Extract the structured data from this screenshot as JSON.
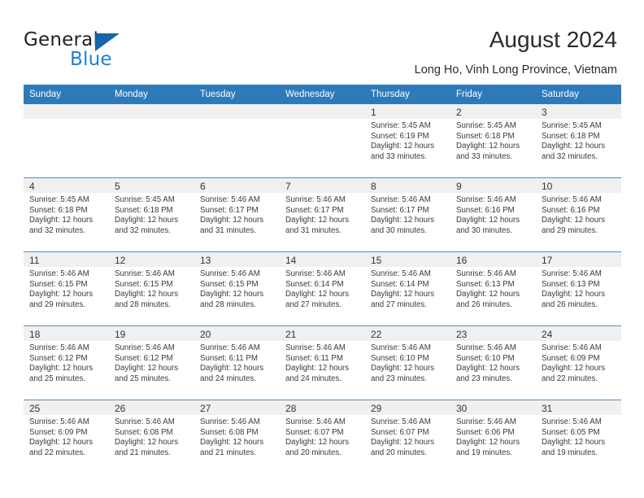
{
  "brand": {
    "name_top": "General",
    "name_bottom": "Blue",
    "triangle_color": "#1565a8",
    "blue_text_color": "#1f7fd0"
  },
  "header": {
    "title": "August 2024",
    "subtitle": "Long Ho, Vinh Long Province, Vietnam"
  },
  "colors": {
    "header_row_bg": "#2e7ab8",
    "header_row_text": "#ffffff",
    "daynum_band_bg": "#f0f0f0",
    "row_separator": "#5b8dbf",
    "cell_bg": "#ffffff"
  },
  "calendar": {
    "weekday_headers": [
      "Sunday",
      "Monday",
      "Tuesday",
      "Wednesday",
      "Thursday",
      "Friday",
      "Saturday"
    ],
    "weeks": [
      [
        {
          "day": "",
          "empty": true
        },
        {
          "day": "",
          "empty": true
        },
        {
          "day": "",
          "empty": true
        },
        {
          "day": "",
          "empty": true
        },
        {
          "day": "1",
          "sunrise": "Sunrise: 5:45 AM",
          "sunset": "Sunset: 6:19 PM",
          "daylight1": "Daylight: 12 hours",
          "daylight2": "and 33 minutes."
        },
        {
          "day": "2",
          "sunrise": "Sunrise: 5:45 AM",
          "sunset": "Sunset: 6:18 PM",
          "daylight1": "Daylight: 12 hours",
          "daylight2": "and 33 minutes."
        },
        {
          "day": "3",
          "sunrise": "Sunrise: 5:45 AM",
          "sunset": "Sunset: 6:18 PM",
          "daylight1": "Daylight: 12 hours",
          "daylight2": "and 32 minutes."
        }
      ],
      [
        {
          "day": "4",
          "sunrise": "Sunrise: 5:45 AM",
          "sunset": "Sunset: 6:18 PM",
          "daylight1": "Daylight: 12 hours",
          "daylight2": "and 32 minutes."
        },
        {
          "day": "5",
          "sunrise": "Sunrise: 5:45 AM",
          "sunset": "Sunset: 6:18 PM",
          "daylight1": "Daylight: 12 hours",
          "daylight2": "and 32 minutes."
        },
        {
          "day": "6",
          "sunrise": "Sunrise: 5:46 AM",
          "sunset": "Sunset: 6:17 PM",
          "daylight1": "Daylight: 12 hours",
          "daylight2": "and 31 minutes."
        },
        {
          "day": "7",
          "sunrise": "Sunrise: 5:46 AM",
          "sunset": "Sunset: 6:17 PM",
          "daylight1": "Daylight: 12 hours",
          "daylight2": "and 31 minutes."
        },
        {
          "day": "8",
          "sunrise": "Sunrise: 5:46 AM",
          "sunset": "Sunset: 6:17 PM",
          "daylight1": "Daylight: 12 hours",
          "daylight2": "and 30 minutes."
        },
        {
          "day": "9",
          "sunrise": "Sunrise: 5:46 AM",
          "sunset": "Sunset: 6:16 PM",
          "daylight1": "Daylight: 12 hours",
          "daylight2": "and 30 minutes."
        },
        {
          "day": "10",
          "sunrise": "Sunrise: 5:46 AM",
          "sunset": "Sunset: 6:16 PM",
          "daylight1": "Daylight: 12 hours",
          "daylight2": "and 29 minutes."
        }
      ],
      [
        {
          "day": "11",
          "sunrise": "Sunrise: 5:46 AM",
          "sunset": "Sunset: 6:15 PM",
          "daylight1": "Daylight: 12 hours",
          "daylight2": "and 29 minutes."
        },
        {
          "day": "12",
          "sunrise": "Sunrise: 5:46 AM",
          "sunset": "Sunset: 6:15 PM",
          "daylight1": "Daylight: 12 hours",
          "daylight2": "and 28 minutes."
        },
        {
          "day": "13",
          "sunrise": "Sunrise: 5:46 AM",
          "sunset": "Sunset: 6:15 PM",
          "daylight1": "Daylight: 12 hours",
          "daylight2": "and 28 minutes."
        },
        {
          "day": "14",
          "sunrise": "Sunrise: 5:46 AM",
          "sunset": "Sunset: 6:14 PM",
          "daylight1": "Daylight: 12 hours",
          "daylight2": "and 27 minutes."
        },
        {
          "day": "15",
          "sunrise": "Sunrise: 5:46 AM",
          "sunset": "Sunset: 6:14 PM",
          "daylight1": "Daylight: 12 hours",
          "daylight2": "and 27 minutes."
        },
        {
          "day": "16",
          "sunrise": "Sunrise: 5:46 AM",
          "sunset": "Sunset: 6:13 PM",
          "daylight1": "Daylight: 12 hours",
          "daylight2": "and 26 minutes."
        },
        {
          "day": "17",
          "sunrise": "Sunrise: 5:46 AM",
          "sunset": "Sunset: 6:13 PM",
          "daylight1": "Daylight: 12 hours",
          "daylight2": "and 26 minutes."
        }
      ],
      [
        {
          "day": "18",
          "sunrise": "Sunrise: 5:46 AM",
          "sunset": "Sunset: 6:12 PM",
          "daylight1": "Daylight: 12 hours",
          "daylight2": "and 25 minutes."
        },
        {
          "day": "19",
          "sunrise": "Sunrise: 5:46 AM",
          "sunset": "Sunset: 6:12 PM",
          "daylight1": "Daylight: 12 hours",
          "daylight2": "and 25 minutes."
        },
        {
          "day": "20",
          "sunrise": "Sunrise: 5:46 AM",
          "sunset": "Sunset: 6:11 PM",
          "daylight1": "Daylight: 12 hours",
          "daylight2": "and 24 minutes."
        },
        {
          "day": "21",
          "sunrise": "Sunrise: 5:46 AM",
          "sunset": "Sunset: 6:11 PM",
          "daylight1": "Daylight: 12 hours",
          "daylight2": "and 24 minutes."
        },
        {
          "day": "22",
          "sunrise": "Sunrise: 5:46 AM",
          "sunset": "Sunset: 6:10 PM",
          "daylight1": "Daylight: 12 hours",
          "daylight2": "and 23 minutes."
        },
        {
          "day": "23",
          "sunrise": "Sunrise: 5:46 AM",
          "sunset": "Sunset: 6:10 PM",
          "daylight1": "Daylight: 12 hours",
          "daylight2": "and 23 minutes."
        },
        {
          "day": "24",
          "sunrise": "Sunrise: 5:46 AM",
          "sunset": "Sunset: 6:09 PM",
          "daylight1": "Daylight: 12 hours",
          "daylight2": "and 22 minutes."
        }
      ],
      [
        {
          "day": "25",
          "sunrise": "Sunrise: 5:46 AM",
          "sunset": "Sunset: 6:09 PM",
          "daylight1": "Daylight: 12 hours",
          "daylight2": "and 22 minutes."
        },
        {
          "day": "26",
          "sunrise": "Sunrise: 5:46 AM",
          "sunset": "Sunset: 6:08 PM",
          "daylight1": "Daylight: 12 hours",
          "daylight2": "and 21 minutes."
        },
        {
          "day": "27",
          "sunrise": "Sunrise: 5:46 AM",
          "sunset": "Sunset: 6:08 PM",
          "daylight1": "Daylight: 12 hours",
          "daylight2": "and 21 minutes."
        },
        {
          "day": "28",
          "sunrise": "Sunrise: 5:46 AM",
          "sunset": "Sunset: 6:07 PM",
          "daylight1": "Daylight: 12 hours",
          "daylight2": "and 20 minutes."
        },
        {
          "day": "29",
          "sunrise": "Sunrise: 5:46 AM",
          "sunset": "Sunset: 6:07 PM",
          "daylight1": "Daylight: 12 hours",
          "daylight2": "and 20 minutes."
        },
        {
          "day": "30",
          "sunrise": "Sunrise: 5:46 AM",
          "sunset": "Sunset: 6:06 PM",
          "daylight1": "Daylight: 12 hours",
          "daylight2": "and 19 minutes."
        },
        {
          "day": "31",
          "sunrise": "Sunrise: 5:46 AM",
          "sunset": "Sunset: 6:05 PM",
          "daylight1": "Daylight: 12 hours",
          "daylight2": "and 19 minutes."
        }
      ]
    ]
  }
}
